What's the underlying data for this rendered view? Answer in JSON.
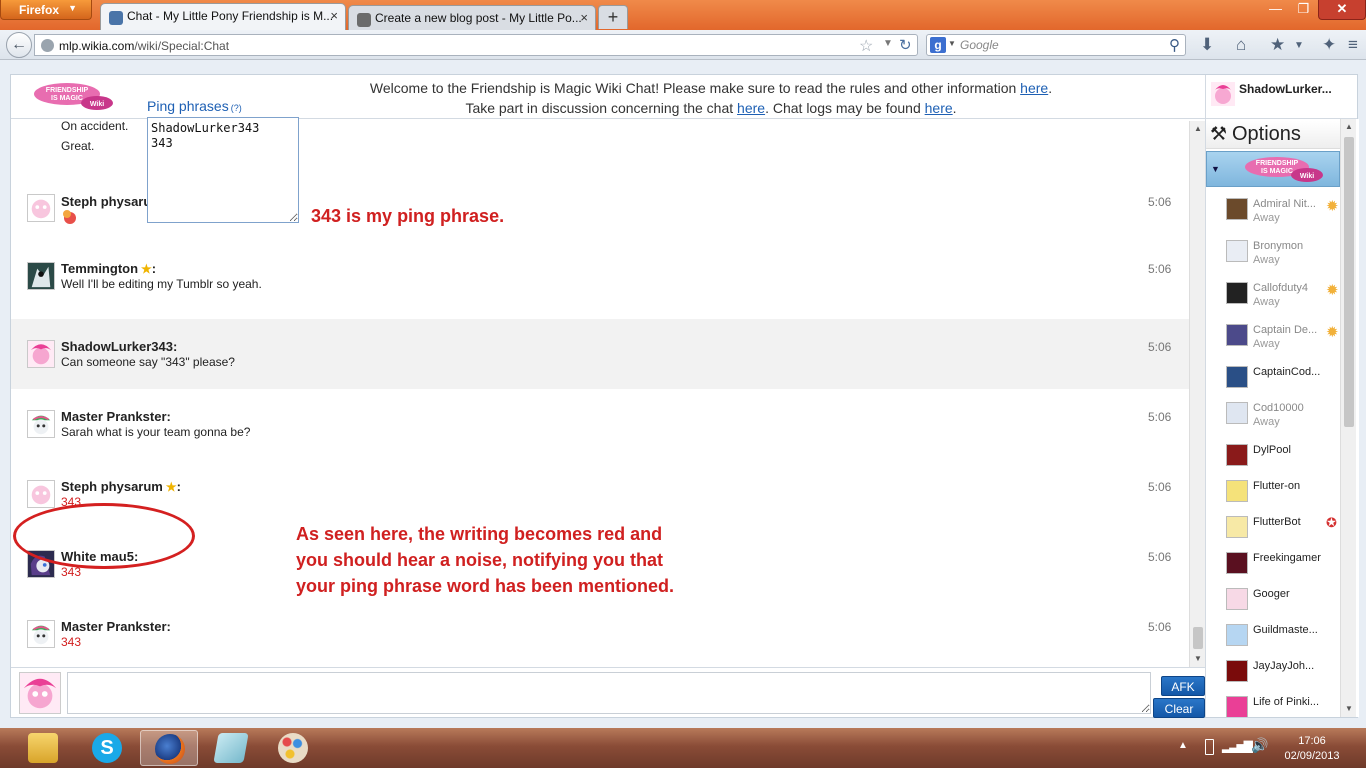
{
  "browser": {
    "menu_label": "Firefox",
    "tabs": [
      {
        "title": "Chat - My Little Pony Friendship is M...",
        "close": "×"
      },
      {
        "title": "Create a new blog post - My Little Po...",
        "close": "×"
      }
    ],
    "new_tab": "+",
    "window_controls": {
      "minimize": "—",
      "maximize": "❐",
      "close": "✕"
    },
    "url_domain": "mlp.wikia.com",
    "url_path": "/wiki/Special:Chat",
    "search_placeholder": "Google"
  },
  "header": {
    "logo_text": "Friendship is Magic Wiki",
    "ping_phrases_label": "Ping phrases",
    "ping_help": "(?)",
    "welcome_line1_pre": "Welcome to the Friendship is Magic Wiki Chat! Please make sure to read the rules and other information ",
    "welcome_line1_link": "here",
    "welcome_line1_post": ".",
    "welcome_line2_a": "Take part in discussion concerning the chat ",
    "welcome_line2_link1": "here",
    "welcome_line2_b": ". Chat logs may be found ",
    "welcome_line2_link2": "here",
    "welcome_line2_c": ".",
    "current_user": "ShadowLurker..."
  },
  "ping_phrases_text": "ShadowLurker343\n343",
  "previous_lines": [
    "On accident.",
    "Great."
  ],
  "messages": [
    {
      "user": "Steph physaru",
      "text": "",
      "time": "5:06",
      "star": false,
      "ping": false
    },
    {
      "user": "Temmington",
      "star": true,
      "text": "Well I'll be editing my Tumblr so yeah.",
      "time": "5:06",
      "ping": false
    },
    {
      "user": "ShadowLurker343:",
      "star": false,
      "text": "Can someone say \"343\" please?",
      "time": "5:06",
      "ping": false
    },
    {
      "user": "Master Prankster:",
      "star": false,
      "text": "Sarah what is your team gonna be?",
      "time": "5:06",
      "ping": false
    },
    {
      "user": "Steph physarum",
      "star": true,
      "text": "343",
      "time": "5:06",
      "ping": true
    },
    {
      "user": "White mau5:",
      "star": false,
      "text": "343",
      "time": "5:06",
      "ping": true
    },
    {
      "user": "Master Prankster:",
      "star": false,
      "text": "343",
      "time": "5:06",
      "ping": true
    }
  ],
  "annotations": {
    "ping_note": "343 is my ping phrase.",
    "result_note": "As seen here, the writing becomes red and you should hear a noise, notifying you that your ping phrase word has been mentioned."
  },
  "input": {
    "afk_label": "AFK",
    "clear_label": "Clear"
  },
  "userlist": {
    "options_label": "Options",
    "users": [
      {
        "name": "Admiral Nit...",
        "status": "Away",
        "badge": "sun"
      },
      {
        "name": "Bronymon",
        "status": "Away",
        "badge": ""
      },
      {
        "name": "Callofduty4",
        "status": "Away",
        "badge": "sun"
      },
      {
        "name": "Captain De...",
        "status": "Away",
        "badge": "sun"
      },
      {
        "name": "CaptainCod...",
        "status": "",
        "badge": ""
      },
      {
        "name": "Cod10000",
        "status": "Away",
        "badge": ""
      },
      {
        "name": "DylPool",
        "status": "",
        "badge": ""
      },
      {
        "name": "Flutter-on",
        "status": "",
        "badge": ""
      },
      {
        "name": "FlutterBot",
        "status": "",
        "badge": "star"
      },
      {
        "name": "Freekingamer",
        "status": "",
        "badge": ""
      },
      {
        "name": "Googer",
        "status": "",
        "badge": ""
      },
      {
        "name": "Guildmaste...",
        "status": "",
        "badge": ""
      },
      {
        "name": "JayJayJoh...",
        "status": "",
        "badge": ""
      },
      {
        "name": "Life of Pinki...",
        "status": "",
        "badge": ""
      }
    ]
  },
  "taskbar": {
    "clock_time": "17:06",
    "clock_date": "02/09/2013"
  },
  "colors": {
    "ping_red": "#d21e1e",
    "link_blue": "#1e60b4",
    "button_blue": "#1458a8"
  }
}
